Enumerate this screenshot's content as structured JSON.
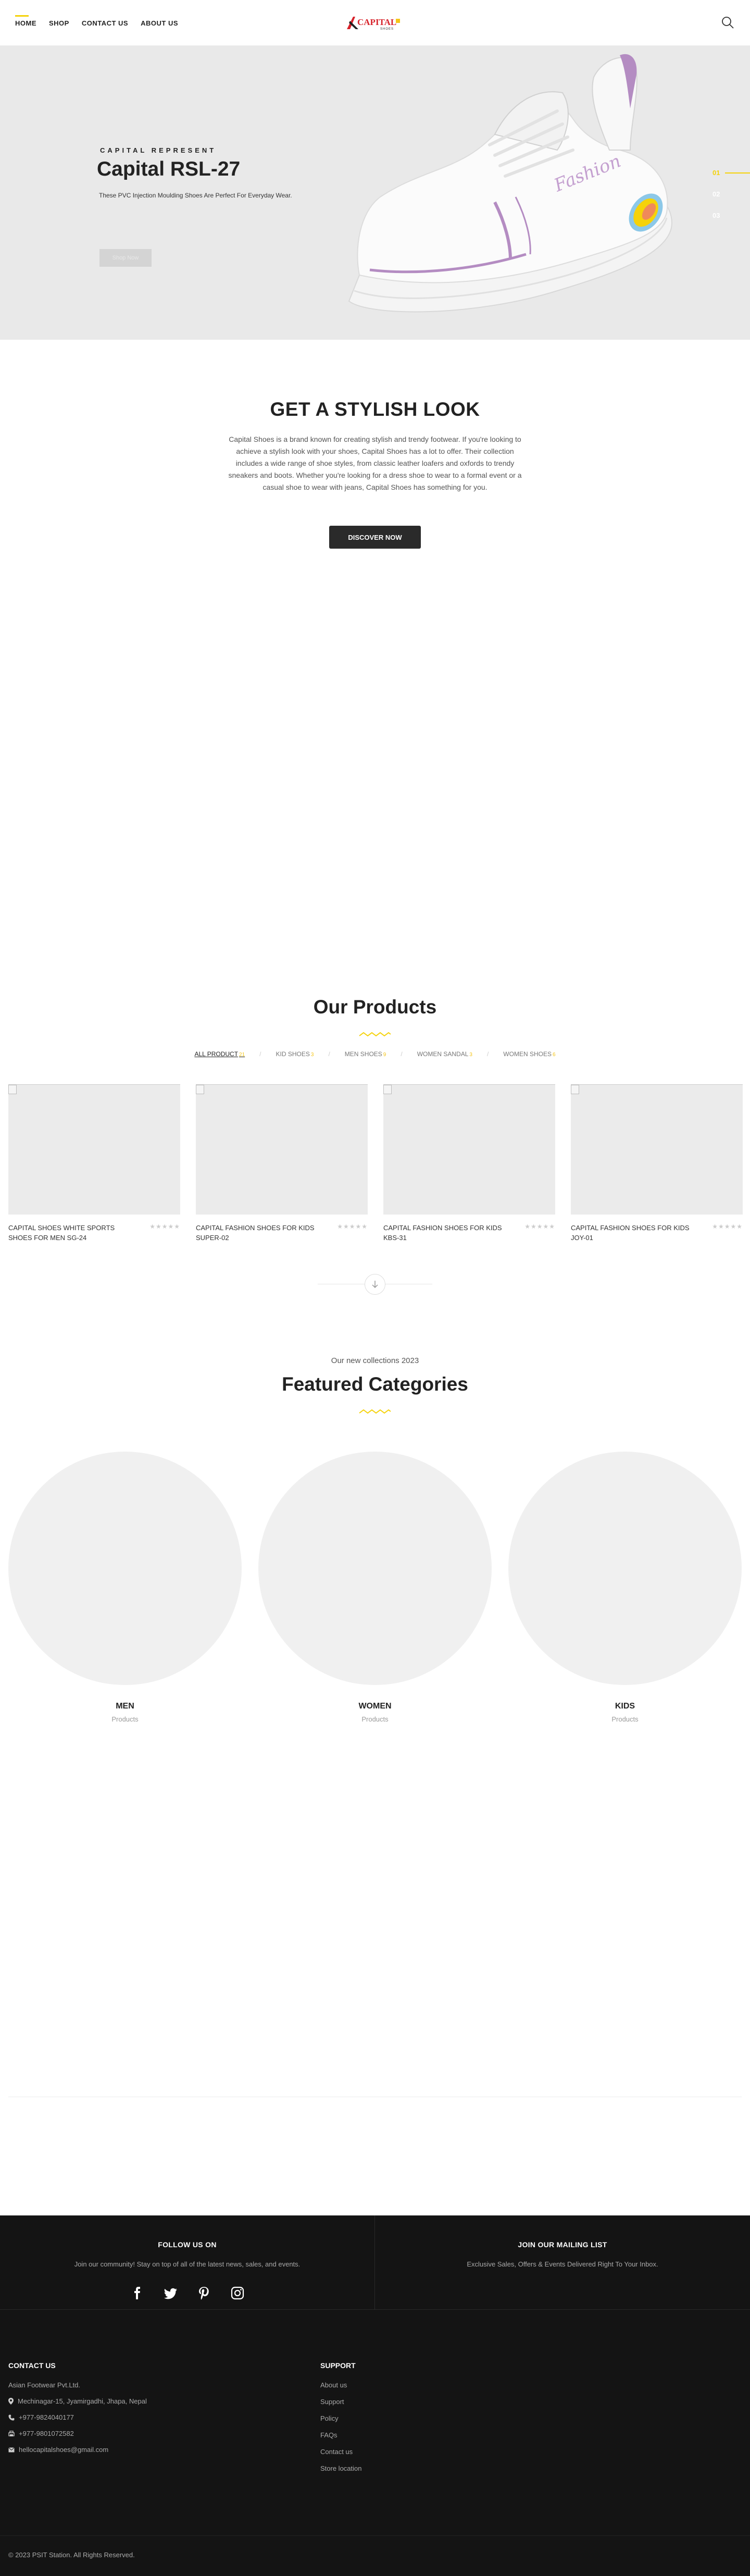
{
  "nav": {
    "items": [
      {
        "label": "HOME"
      },
      {
        "label": "SHOP"
      },
      {
        "label": "CONTACT US"
      },
      {
        "label": "ABOUT US"
      }
    ],
    "logo_text": "CAPITAL",
    "logo_sub": "SHOES"
  },
  "hero": {
    "eyebrow": "CAPITAL REPRESENT",
    "title": "Capital RSL-27",
    "description": "These PVC Injection Moulding Shoes Are Perfect For Everyday Wear.",
    "button_label": "Shop Now",
    "slides": [
      "01",
      "02",
      "03"
    ],
    "active_slide": 0
  },
  "stylish": {
    "title": "GET A STYLISH LOOK",
    "text": "Capital Shoes is a brand known for creating stylish and trendy footwear. If you're looking to achieve a stylish look with your shoes, Capital Shoes has a lot to offer. Their collection includes a wide range of shoe styles, from classic leather loafers and oxfords to trendy sneakers and boots. Whether you're looking for a dress shoe to wear to a formal event or a casual shoe to wear with jeans, Capital Shoes has something for you.",
    "button_label": "DISCOVER NOW"
  },
  "products": {
    "title": "Our Products",
    "filters": [
      {
        "label": "ALL PRODUCT",
        "count": "21"
      },
      {
        "label": "KID SHOES",
        "count": "3"
      },
      {
        "label": "MEN SHOES",
        "count": "9"
      },
      {
        "label": "WOMEN SANDAL",
        "count": "3"
      },
      {
        "label": "WOMEN SHOES",
        "count": "6"
      }
    ],
    "items": [
      {
        "name": "CAPITAL SHOES WHITE SPORTS SHOES FOR MEN SG-24"
      },
      {
        "name": "CAPITAL FASHION SHOES FOR KIDS SUPER-02"
      },
      {
        "name": "CAPITAL FASHION SHOES FOR KIDS KBS-31"
      },
      {
        "name": "CAPITAL FASHION SHOES FOR KIDS JOY-01"
      }
    ],
    "stars": "★★★★★"
  },
  "categories": {
    "subtitle": "Our new collections 2023",
    "title": "Featured Categories",
    "items": [
      {
        "name": "MEN",
        "meta": "Products"
      },
      {
        "name": "WOMEN",
        "meta": "Products"
      },
      {
        "name": "KIDS",
        "meta": "Products"
      }
    ]
  },
  "footer": {
    "follow_title": "FOLLOW US ON",
    "follow_text": "Join our community! Stay on top of all of the latest news, sales, and events.",
    "mailing_title": "JOIN OUR MAILING LIST",
    "mailing_text": "Exclusive Sales, Offers & Events Delivered Right To Your Inbox.",
    "socials": [
      "facebook-icon",
      "twitter-icon",
      "pinterest-icon",
      "instagram-icon"
    ],
    "contact": {
      "title": "CONTACT US",
      "company": "Asian Footwear Pvt.Ltd.",
      "address": "Mechinagar-15, Jyamirgadhi, Jhapa, Nepal",
      "phone": "+977-9824040177",
      "fax": "+977-9801072582",
      "email": "hellocapitalshoes@gmail.com"
    },
    "support": {
      "title": "SUPPORT",
      "links": [
        "About us",
        "Support",
        "Policy",
        "FAQs",
        "Contact us",
        "Store location"
      ]
    },
    "copyright": "© 2023 PSIT Station. All Rights Reserved."
  },
  "colors": {
    "accent": "#f5d20a",
    "footer_bg": "#141414",
    "button_dark": "#2a2a2a",
    "hero_bg": "#e9e9e9"
  }
}
